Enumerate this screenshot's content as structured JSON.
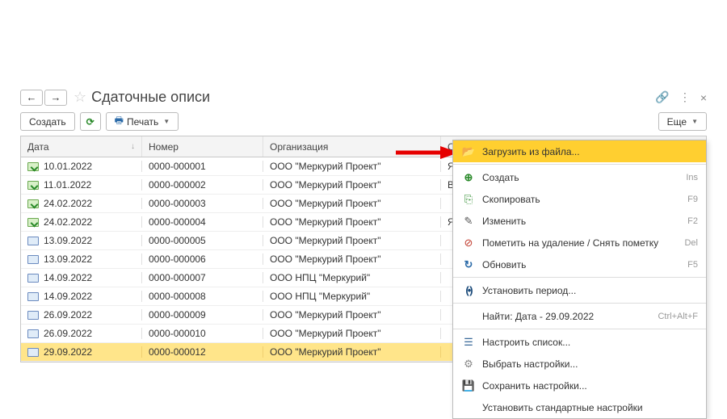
{
  "header": {
    "title": "Сдаточные описи"
  },
  "toolbar": {
    "create_label": "Создать",
    "print_label": "Печать",
    "more_label": "Еще"
  },
  "columns": {
    "date": "Дата",
    "number": "Номер",
    "org": "Организация",
    "responsible": "Ответственный"
  },
  "rows": [
    {
      "date": "10.01.2022",
      "number": "0000-000001",
      "org": "ООО \"Меркурий Проект\"",
      "resp": "Яковл",
      "icon": "green"
    },
    {
      "date": "11.01.2022",
      "number": "0000-000002",
      "org": "ООО \"Меркурий Проект\"",
      "resp": "Велик",
      "icon": "green"
    },
    {
      "date": "24.02.2022",
      "number": "0000-000003",
      "org": "ООО \"Меркурий Проект\"",
      "resp": "",
      "icon": "green"
    },
    {
      "date": "24.02.2022",
      "number": "0000-000004",
      "org": "ООО \"Меркурий Проект\"",
      "resp": "Яковл",
      "icon": "green"
    },
    {
      "date": "13.09.2022",
      "number": "0000-000005",
      "org": "ООО \"Меркурий Проект\"",
      "resp": "",
      "icon": "blue"
    },
    {
      "date": "13.09.2022",
      "number": "0000-000006",
      "org": "ООО \"Меркурий Проект\"",
      "resp": "",
      "icon": "blue"
    },
    {
      "date": "14.09.2022",
      "number": "0000-000007",
      "org": "ООО НПЦ \"Меркурий\"",
      "resp": "",
      "icon": "blue"
    },
    {
      "date": "14.09.2022",
      "number": "0000-000008",
      "org": "ООО НПЦ \"Меркурий\"",
      "resp": "",
      "icon": "blue"
    },
    {
      "date": "26.09.2022",
      "number": "0000-000009",
      "org": "ООО \"Меркурий Проект\"",
      "resp": "",
      "icon": "blue"
    },
    {
      "date": "26.09.2022",
      "number": "0000-000010",
      "org": "ООО \"Меркурий Проект\"",
      "resp": "",
      "icon": "blue"
    },
    {
      "date": "29.09.2022",
      "number": "0000-000012",
      "org": "ООО \"Меркурий Проект\"",
      "resp": "",
      "icon": "blue",
      "selected": true
    }
  ],
  "dropdown": {
    "load_from_file": "Загрузить из файла...",
    "create": "Создать",
    "create_sc": "Ins",
    "copy": "Скопировать",
    "copy_sc": "F9",
    "edit": "Изменить",
    "edit_sc": "F2",
    "mark_delete": "Пометить на удаление / Снять пометку",
    "mark_delete_sc": "Del",
    "refresh": "Обновить",
    "refresh_sc": "F5",
    "set_period": "Установить период...",
    "find": "Найти: Дата - 29.09.2022",
    "find_sc": "Ctrl+Alt+F",
    "configure_list": "Настроить список...",
    "choose_settings": "Выбрать настройки...",
    "save_settings": "Сохранить настройки...",
    "set_default": "Установить стандартные настройки"
  }
}
